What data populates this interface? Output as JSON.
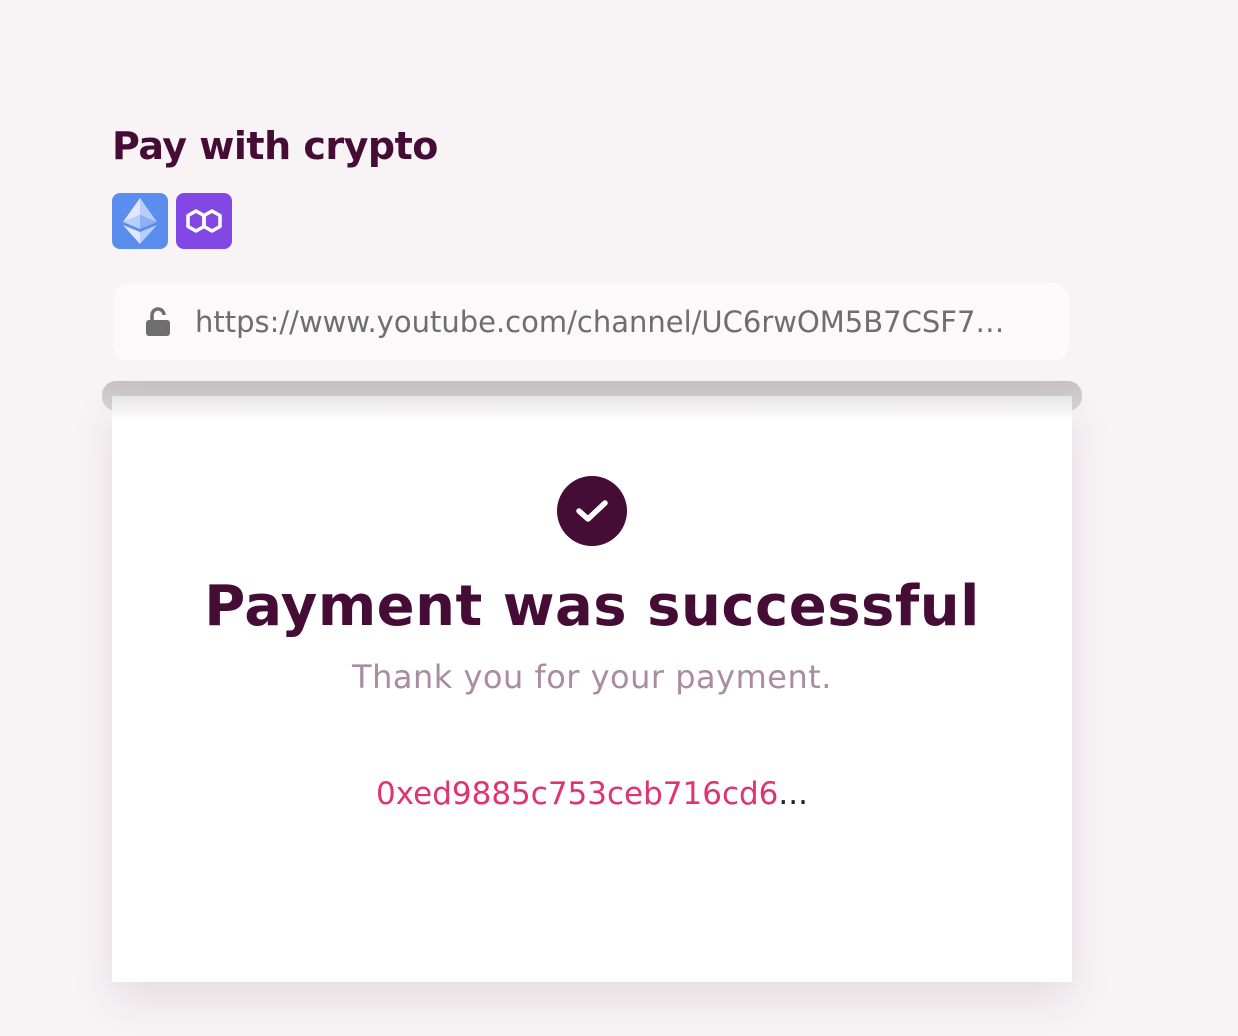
{
  "page": {
    "title": "Pay with crypto"
  },
  "chains": [
    {
      "name": "ethereum-icon",
      "color": "#5b8def"
    },
    {
      "name": "polygon-icon",
      "color": "#8247e5"
    }
  ],
  "url_bar": {
    "icon": "unlock-icon",
    "url": "https://www.youtube.com/channel/UC6rwOM5B7CSF7…"
  },
  "result": {
    "icon": "check-circle-icon",
    "headline": "Payment was successful",
    "message": "Thank you for your payment.",
    "tx_hash": "0xed9885c753ceb716cd6",
    "tx_ellipsis": "..."
  },
  "colors": {
    "brand": "#450c36",
    "accent": "#e0336f",
    "muted": "#a98ca1"
  }
}
